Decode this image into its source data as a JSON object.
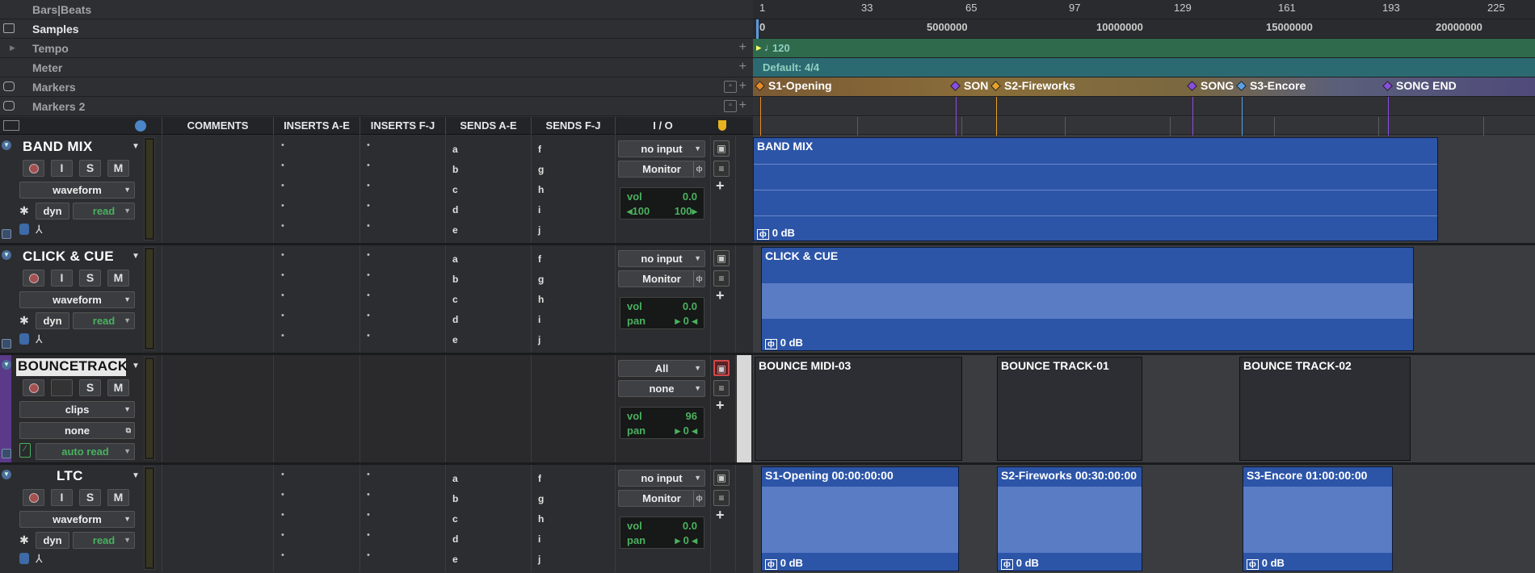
{
  "rulers": {
    "bars_beats": "Bars|Beats",
    "samples": "Samples",
    "tempo": "Tempo",
    "meter": "Meter",
    "markers": "Markers",
    "markers2": "Markers 2"
  },
  "columns": {
    "comments": "COMMENTS",
    "inserts_ae": "INSERTS A-E",
    "inserts_fj": "INSERTS F-J",
    "sends_ae": "SENDS A-E",
    "sends_fj": "SENDS F-J",
    "io": "I / O"
  },
  "bar_ticks": [
    "1",
    "33",
    "65",
    "97",
    "129",
    "161",
    "193",
    "225"
  ],
  "sample_ticks": [
    "0",
    "5000000",
    "10000000",
    "15000000",
    "20000000"
  ],
  "tempo_value": "120",
  "meter_value": "Default: 4/4",
  "markers": [
    {
      "label": "S1-Opening",
      "color": "#e78b28"
    },
    {
      "label": "SON",
      "color": "#8a4de0"
    },
    {
      "label": "S2-Fireworks",
      "color": "#e7a028"
    },
    {
      "label": "SONG",
      "color": "#8a4de0"
    },
    {
      "label": "S3-Encore",
      "color": "#5aa0e8"
    },
    {
      "label": "SONG END",
      "color": "#8a4de0"
    }
  ],
  "send_letters": {
    "ae": [
      "a",
      "b",
      "c",
      "d",
      "e"
    ],
    "fj": [
      "f",
      "g",
      "h",
      "i",
      "j"
    ]
  },
  "btn": {
    "input": "I",
    "solo": "S",
    "mute": "M",
    "dyn": "dyn",
    "plus": "+"
  },
  "tracks": [
    {
      "name": "BAND MIX",
      "view": "waveform",
      "automation": "read",
      "input": "no input",
      "output": "Monitor",
      "vol_label": "vol",
      "vol": "0.0",
      "pan_l": "100",
      "pan_r": "100",
      "clip": "BAND MIX",
      "clip_db": "0 dB"
    },
    {
      "name": "CLICK & CUE",
      "view": "waveform",
      "automation": "read",
      "input": "no input",
      "output": "Monitor",
      "vol_label": "vol",
      "vol": "0.0",
      "pan_label": "pan",
      "pan": "0",
      "clip": "CLICK & CUE",
      "clip_db": "0 dB"
    },
    {
      "name": "BOUNCETRACK",
      "view": "clips",
      "view2": "none",
      "automation": "auto read",
      "input": "All",
      "output": "none",
      "vol_label": "vol",
      "vol": "96",
      "pan_label": "pan",
      "pan": "0",
      "clips": [
        "BOUNCE MIDI-03",
        "BOUNCE TRACK-01",
        "BOUNCE TRACK-02"
      ]
    },
    {
      "name": "LTC",
      "view": "waveform",
      "automation": "read",
      "input": "no input",
      "output": "Monitor",
      "vol_label": "vol",
      "vol": "0.0",
      "pan_label": "pan",
      "pan": "0",
      "clips": [
        "S1-Opening 00:00:00:00",
        "S2-Fireworks 00:30:00:00",
        "S3-Encore 01:00:00:00"
      ],
      "clip_db": "0 dB"
    }
  ]
}
